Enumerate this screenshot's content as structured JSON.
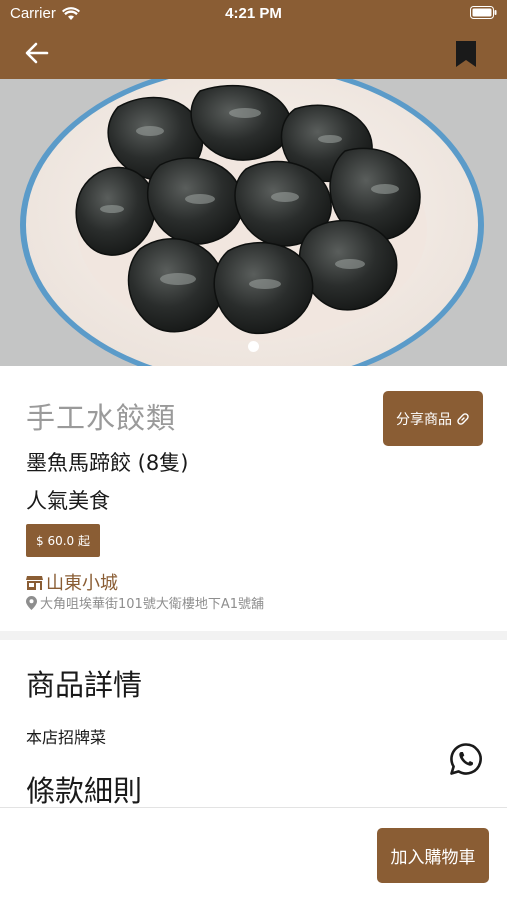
{
  "status_bar": {
    "carrier": "Carrier",
    "time": "4:21 PM"
  },
  "nav": {
    "back_icon": "arrow-left-icon",
    "bookmark_icon": "bookmark-icon"
  },
  "gallery": {
    "image_subject": "plate of black squid-ink dumplings",
    "page_count": 1,
    "current_page": 1
  },
  "product": {
    "category": "手工水餃類",
    "name": "墨魚馬蹄餃 (8隻)",
    "tagline": "人氣美食",
    "price": "$ 60.0 起",
    "share_label": "分享商品"
  },
  "shop": {
    "name": "山東小城",
    "address": "大角咀埃華街101號大衛樓地下A1號舖"
  },
  "details": {
    "title": "商品詳情",
    "text": "本店招牌菜"
  },
  "terms": {
    "title": "條款細則"
  },
  "actions": {
    "add_to_cart": "加入購物車"
  },
  "colors": {
    "brand": "#8a5d34",
    "whatsapp_icon": "#1a1a1a"
  }
}
